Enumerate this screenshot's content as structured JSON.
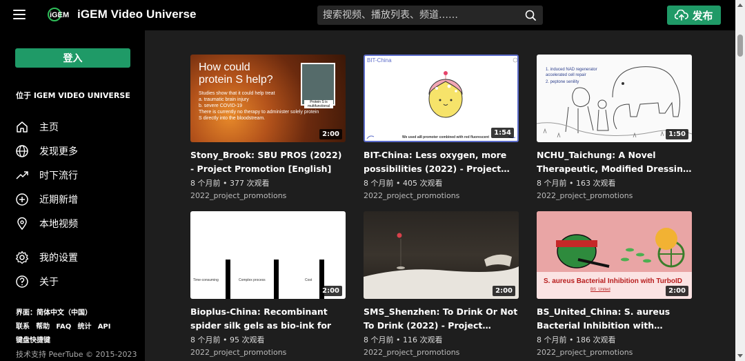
{
  "header": {
    "brand": "iGEM Video Universe",
    "search_placeholder": "搜索视频、播放列表、频道……",
    "publish_label": "发布"
  },
  "sidebar": {
    "login_label": "登入",
    "heading": "位于 IGEM VIDEO UNIVERSE",
    "nav": [
      {
        "label": "主页",
        "icon": "home-icon"
      },
      {
        "label": "发现更多",
        "icon": "globe-icon"
      },
      {
        "label": "时下流行",
        "icon": "trending-icon"
      },
      {
        "label": "近期新增",
        "icon": "plus-circle-icon"
      },
      {
        "label": "本地视频",
        "icon": "location-icon"
      }
    ],
    "settings": [
      {
        "label": "我的设置",
        "icon": "gear-icon"
      },
      {
        "label": "关于",
        "icon": "help-icon"
      }
    ],
    "footer": {
      "interface_label": "界面：",
      "interface_value": "简体中文（中国）",
      "links": [
        "联系",
        "帮助",
        "FAQ",
        "统计",
        "API"
      ],
      "shortcuts": "键盘快捷键",
      "copyright": "技术支持 PeerTube © 2015-2023"
    }
  },
  "videos": [
    {
      "title": "Stony_Brook: SBU PROS (2022) - Project Promotion [English]",
      "meta": "8 个月前 • 377 次观看",
      "channel": "2022_project_promotions",
      "duration": "2:00",
      "thumb_big_text": "How could protein S help?",
      "thumb_small_text": "Studies show that it could help treat\n    a. traumatic brain injury\n    b. severe COVID-19\nThere is currently no therapy to administer solely protein S directly into the bloodstream.",
      "thumb_inset_label": "Protein S is multifunctional"
    },
    {
      "title": "BIT-China: Less oxygen, more possibilities (2022) - Project…",
      "meta": "8 个月前 • 405 次观看",
      "channel": "2022_project_promotions",
      "duration": "1:54",
      "thumb_header": "BIT-China",
      "thumb_caption": "We used ai8 promoter combined with red fluorescent"
    },
    {
      "title": "NCHU_Taichung: A Novel Therapeutic, Modified Dressin…",
      "meta": "8 个月前 • 163 次观看",
      "channel": "2022_project_promotions",
      "duration": "1:50",
      "thumb_line1": "1. induced NAD regenerator accelerated cell repair",
      "thumb_line2": "2. peptone senility"
    },
    {
      "title": "Bioplus-China: Recombinant spider silk gels as bio-ink for 3…",
      "meta": "8 个月前 • 95 次观看",
      "channel": "2022_project_promotions",
      "duration": "2:00",
      "thumb_labels": [
        "Time-consuming",
        "Complex process",
        "Cost"
      ]
    },
    {
      "title": "SMS_Shenzhen: To Drink Or Not To Drink (2022) - Project…",
      "meta": "8 个月前 • 116 次观看",
      "channel": "2022_project_promotions",
      "duration": "2:00"
    },
    {
      "title": "BS_United_China: S. aureus Bacterial Inhibition with…",
      "meta": "8 个月前 • 186 次观看",
      "channel": "2022_project_promotions",
      "duration": "2:00",
      "thumb_caption": "S. aureus Bacterial Inhibition with TurboID",
      "thumb_subcaption": "BS_United"
    }
  ],
  "colors": {
    "accent": "#1f9a67",
    "background": "#1e1e1e",
    "header": "#000000"
  }
}
